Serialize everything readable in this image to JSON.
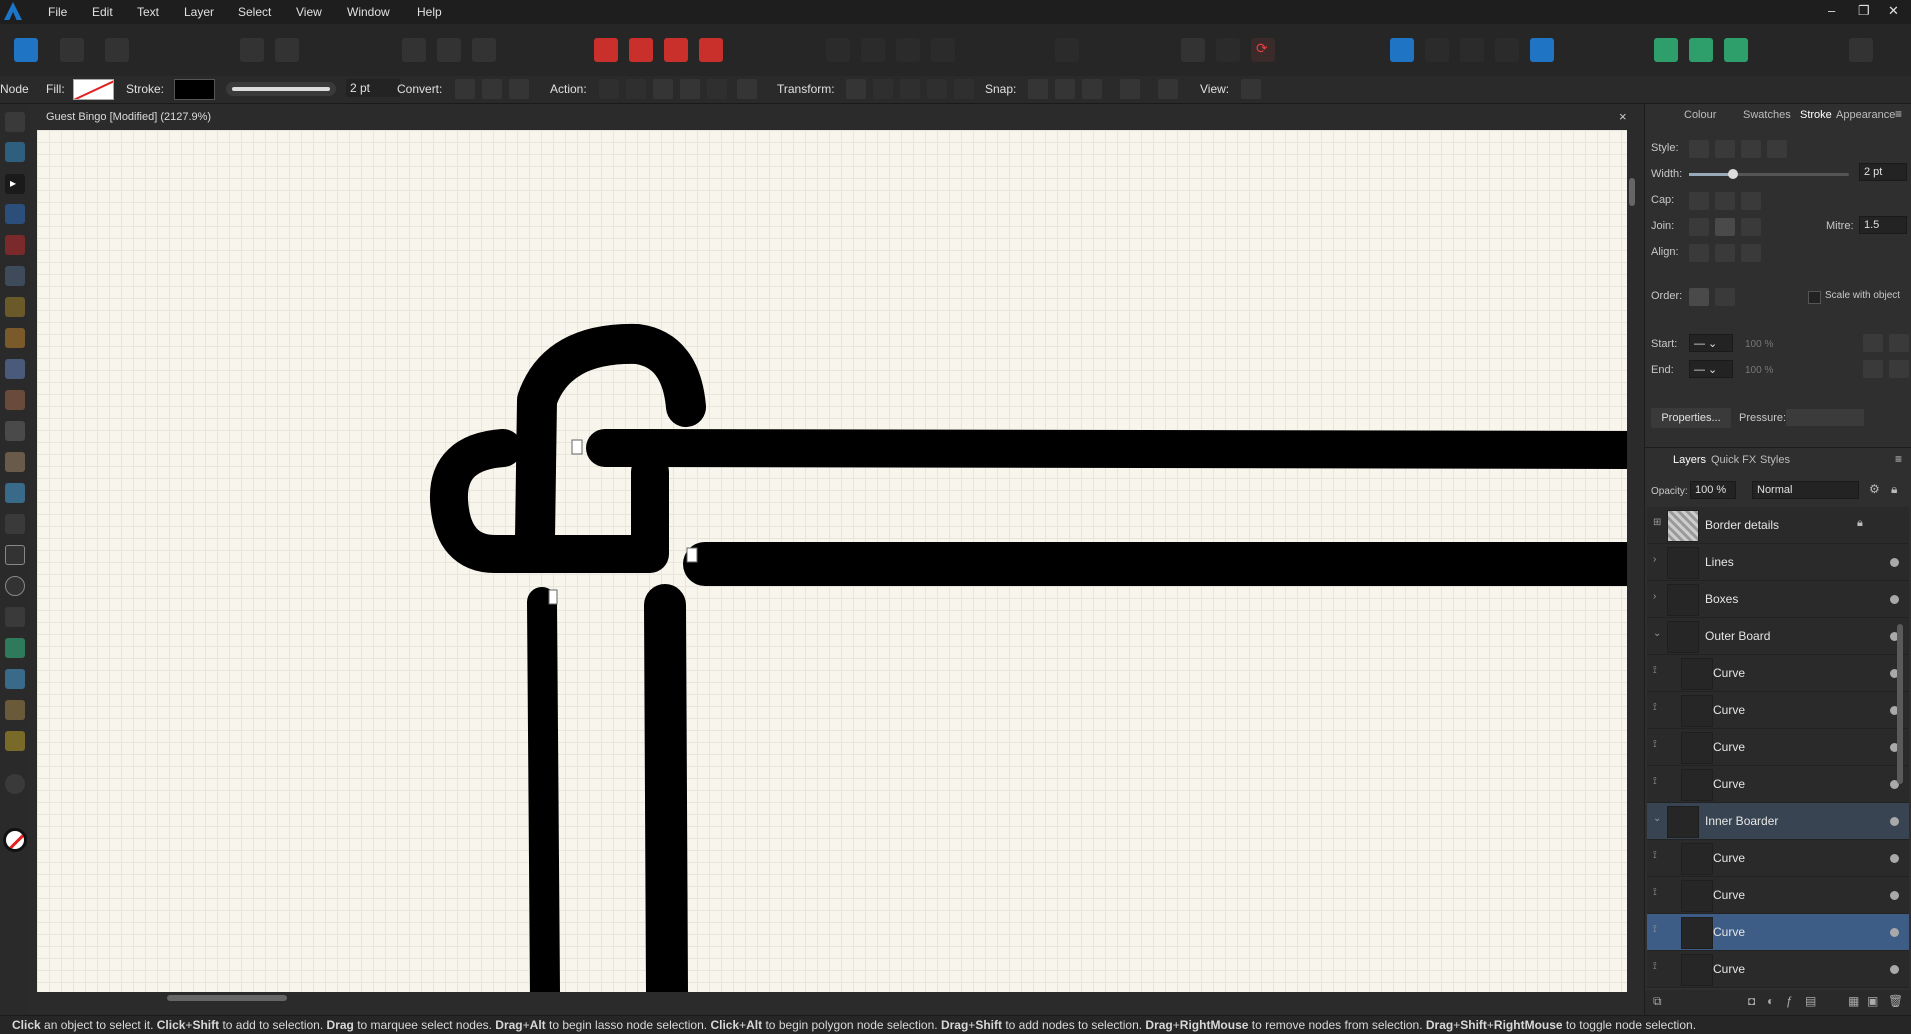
{
  "menu": [
    "File",
    "Edit",
    "Text",
    "Layer",
    "Select",
    "View",
    "Window",
    "Help"
  ],
  "context": {
    "tool": "Node",
    "fill_label": "Fill:",
    "stroke_label": "Stroke:",
    "stroke_width": "2 pt",
    "convert_label": "Convert:",
    "action_label": "Action:",
    "transform_label": "Transform:",
    "snap_label": "Snap:",
    "view_label": "View:"
  },
  "document": {
    "title": "Guest Bingo [Modified] (2127.9%)",
    "close": "×"
  },
  "stroke_panel": {
    "tabs": [
      "Colour",
      "Swatches",
      "Stroke",
      "Appearance"
    ],
    "active_tab": "Stroke",
    "style_label": "Style:",
    "width_label": "Width:",
    "width_value": "2 pt",
    "width_slider_fraction": 0.27,
    "cap_label": "Cap:",
    "join_label": "Join:",
    "mitre_label": "Mitre:",
    "mitre_value": "1.5",
    "align_label": "Align:",
    "order_label": "Order:",
    "scale_label": "Scale with object",
    "start_label": "Start:",
    "end_label": "End:",
    "start_pct": "100 %",
    "end_pct": "100 %",
    "properties_button": "Properties...",
    "pressure_label": "Pressure:"
  },
  "layers_panel": {
    "tabs": [
      "Layers",
      "Quick FX",
      "Styles"
    ],
    "active_tab": "Layers",
    "opacity_label": "Opacity:",
    "opacity_value": "100 %",
    "blend_mode": "Normal",
    "layers": [
      {
        "name": "Border details",
        "indent": 0,
        "type": "pixel",
        "locked": true
      },
      {
        "name": "Lines",
        "indent": 0,
        "type": "group"
      },
      {
        "name": "Boxes",
        "indent": 0,
        "type": "group"
      },
      {
        "name": "Outer Board",
        "indent": 0,
        "type": "group-open"
      },
      {
        "name": "Curve",
        "indent": 1,
        "type": "curve"
      },
      {
        "name": "Curve",
        "indent": 1,
        "type": "curve"
      },
      {
        "name": "Curve",
        "indent": 1,
        "type": "curve"
      },
      {
        "name": "Curve",
        "indent": 1,
        "type": "curve"
      },
      {
        "name": "Inner Boarder",
        "indent": 0,
        "type": "group-open",
        "highlight": true
      },
      {
        "name": "Curve",
        "indent": 1,
        "type": "curve"
      },
      {
        "name": "Curve",
        "indent": 1,
        "type": "curve"
      },
      {
        "name": "Curve",
        "indent": 1,
        "type": "curve",
        "selected": true
      },
      {
        "name": "Curve",
        "indent": 1,
        "type": "curve"
      }
    ]
  },
  "status": [
    {
      "t": "Click",
      "b": true
    },
    {
      "t": " an object to select it. "
    },
    {
      "t": "Click",
      "b": true
    },
    {
      "t": "+"
    },
    {
      "t": "Shift",
      "b": true
    },
    {
      "t": " to add to selection. "
    },
    {
      "t": "Drag",
      "b": true
    },
    {
      "t": " to marquee select nodes. "
    },
    {
      "t": "Drag",
      "b": true
    },
    {
      "t": "+"
    },
    {
      "t": "Alt",
      "b": true
    },
    {
      "t": " to begin lasso node selection. "
    },
    {
      "t": "Click",
      "b": true
    },
    {
      "t": "+"
    },
    {
      "t": "Alt",
      "b": true
    },
    {
      "t": " to begin polygon node selection. "
    },
    {
      "t": "Drag",
      "b": true
    },
    {
      "t": "+"
    },
    {
      "t": "Shift",
      "b": true
    },
    {
      "t": " to add nodes to selection. "
    },
    {
      "t": "Drag",
      "b": true
    },
    {
      "t": "+"
    },
    {
      "t": "RightMouse",
      "b": true
    },
    {
      "t": " to remove nodes from selection. "
    },
    {
      "t": "Drag",
      "b": true
    },
    {
      "t": "+"
    },
    {
      "t": "Shift",
      "b": true
    },
    {
      "t": "+"
    },
    {
      "t": "RightMouse",
      "b": true
    },
    {
      "t": " to toggle node selection."
    }
  ],
  "colors": {
    "selection": "#3d5d86",
    "accent_blue": "#1f74c4",
    "accent_red": "#c9302c",
    "canvas": "#f7f5ec"
  }
}
